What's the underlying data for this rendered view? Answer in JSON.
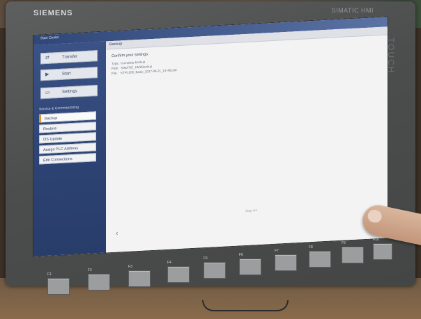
{
  "device": {
    "brand": "SIEMENS",
    "model": "SIMATIC HMI",
    "touch_label": "TOUCH"
  },
  "app": {
    "title": "Start Center"
  },
  "sidebar": {
    "main_buttons": [
      {
        "label": "Transfer",
        "icon": "transfer-icon"
      },
      {
        "label": "Start",
        "icon": "play-icon"
      },
      {
        "label": "Settings",
        "icon": "settings-icon"
      }
    ],
    "section_title": "Service & Commissioning",
    "sub_items": [
      {
        "label": "Backup",
        "active": true
      },
      {
        "label": "Restore",
        "active": false
      },
      {
        "label": "OS Update",
        "active": false
      },
      {
        "label": "Assign PLC Address",
        "active": false
      },
      {
        "label": "Edit Connections",
        "active": false
      }
    ]
  },
  "content": {
    "header": "Backup",
    "confirm_title": "Confirm your settings:",
    "details": [
      {
        "key": "Type:",
        "value": "Complete backup"
      },
      {
        "key": "Path:",
        "value": "SIMATIC_HMI/Backup"
      },
      {
        "key": "File:",
        "value": "KTP1200_Basic_2017-06-21_14-48.psb"
      }
    ],
    "step_text": "Step 4/4",
    "back_glyph": "‹"
  },
  "function_keys": [
    "F1",
    "F2",
    "F3",
    "F4",
    "F5",
    "F6",
    "F7",
    "F8",
    "F9",
    "F10"
  ],
  "colors": {
    "accent": "#e0952b",
    "sidebar": "#2c4272"
  }
}
